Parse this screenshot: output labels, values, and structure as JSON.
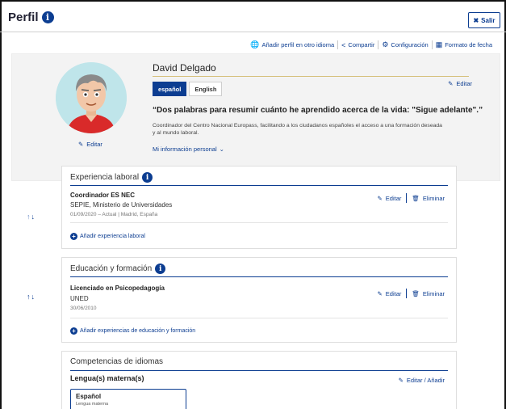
{
  "header": {
    "title": "Perfil",
    "logout_label": "Salir"
  },
  "toolbar": [
    {
      "icon": "globe-icon",
      "label": "Añadir perfil en otro idioma"
    },
    {
      "icon": "share-icon",
      "label": "Compartir"
    },
    {
      "icon": "gear-icon",
      "label": "Configuración"
    },
    {
      "icon": "calendar-icon",
      "label": "Formato de fecha"
    }
  ],
  "profile": {
    "name": "David Delgado",
    "languages": [
      "español",
      "English"
    ],
    "edit_label": "Editar",
    "avatar_edit_label": "Editar",
    "quote": "“Dos palabras para resumir cuánto he aprendido acerca de la vida: \"Sigue adelante\".”",
    "description": "Coordinador del Centro Nacional Europass, facilitando a los ciudadanos españoles el acceso a una formación deseada y al mundo laboral.",
    "more_info_label": "Mi información personal"
  },
  "experience": {
    "title": "Experiencia laboral",
    "item": {
      "role": "Coordinador ES NEC",
      "org": "SEPIE, Ministerio de Universidades",
      "meta": "01/09/2020 – Actual  |  Madrid, España"
    },
    "edit_label": "Editar",
    "delete_label": "Eliminar",
    "add_label": "Añadir experiencia laboral"
  },
  "education": {
    "title": "Educación y formación",
    "item": {
      "degree": "Licenciado en Psicopedagogía",
      "org": "UNED",
      "meta": "30/06/2010"
    },
    "edit_label": "Editar",
    "delete_label": "Eliminar",
    "add_label": "Añadir experiencias de educación y formación"
  },
  "languages_section": {
    "title": "Competencias de idiomas",
    "subtitle": "Lengua(s) materna(s)",
    "edit_label": "Editar / Añadir",
    "card_title": "Español",
    "card_sub": "Lengua materna"
  },
  "colors": {
    "primary": "#0c3d91",
    "profile_bg": "#f3f3f3",
    "accent_rule": "#d6c07a"
  }
}
